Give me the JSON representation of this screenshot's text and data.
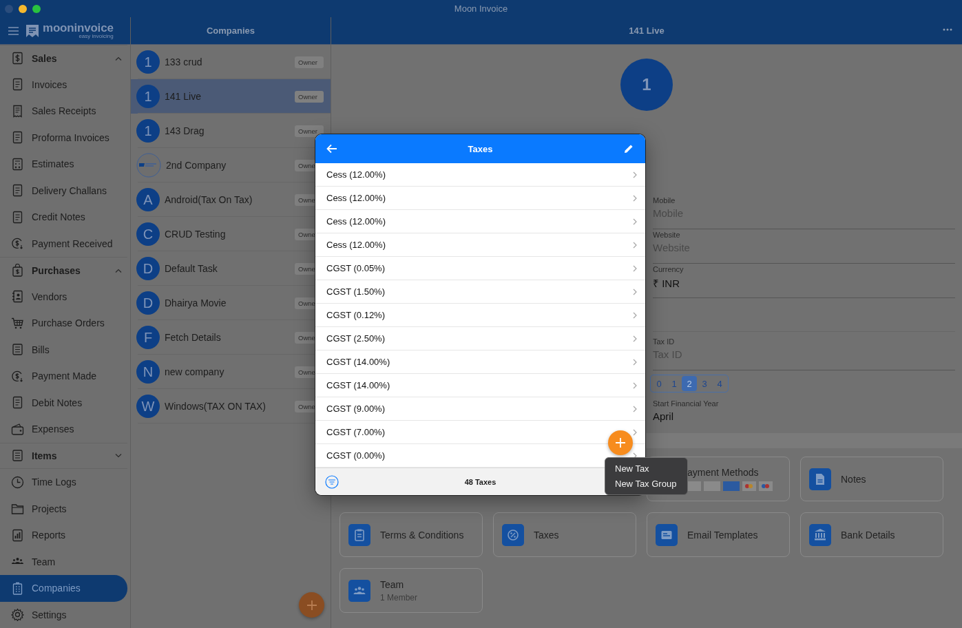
{
  "window": {
    "title": "Moon Invoice"
  },
  "sidebar": {
    "logo": {
      "name": "mooninvoice",
      "tagline": "easy invoicing"
    },
    "items": [
      {
        "kind": "section",
        "label": "Sales",
        "expanded": true,
        "selected": false
      },
      {
        "kind": "item",
        "label": "Invoices",
        "selected": false
      },
      {
        "kind": "item",
        "label": "Sales Receipts",
        "selected": false
      },
      {
        "kind": "item",
        "label": "Proforma Invoices",
        "selected": false
      },
      {
        "kind": "item",
        "label": "Estimates",
        "selected": false
      },
      {
        "kind": "item",
        "label": "Delivery Challans",
        "selected": false
      },
      {
        "kind": "item",
        "label": "Credit Notes",
        "selected": false
      },
      {
        "kind": "item",
        "label": "Payment Received",
        "selected": false
      },
      {
        "kind": "section",
        "label": "Purchases",
        "expanded": true,
        "selected": false
      },
      {
        "kind": "item",
        "label": "Vendors",
        "selected": false
      },
      {
        "kind": "item",
        "label": "Purchase Orders",
        "selected": false
      },
      {
        "kind": "item",
        "label": "Bills",
        "selected": false
      },
      {
        "kind": "item",
        "label": "Payment Made",
        "selected": false
      },
      {
        "kind": "item",
        "label": "Debit Notes",
        "selected": false
      },
      {
        "kind": "item",
        "label": "Expenses",
        "selected": false
      },
      {
        "kind": "section",
        "label": "Items",
        "expanded": false,
        "selected": false
      },
      {
        "kind": "item",
        "label": "Time Logs",
        "selected": false
      },
      {
        "kind": "item",
        "label": "Projects",
        "selected": false
      },
      {
        "kind": "item",
        "label": "Reports",
        "selected": false
      },
      {
        "kind": "item",
        "label": "Team",
        "selected": false
      },
      {
        "kind": "item",
        "label": "Companies",
        "selected": true
      },
      {
        "kind": "item",
        "label": "Settings",
        "selected": false
      }
    ]
  },
  "companies": {
    "header": "Companies",
    "rows": [
      {
        "kind": "letter",
        "initial": "1",
        "name": "133 crud",
        "badge": "Owner",
        "selected": false
      },
      {
        "kind": "letter",
        "initial": "1",
        "name": "141 Live",
        "badge": "Owner",
        "selected": true
      },
      {
        "kind": "letter",
        "initial": "1",
        "name": "143 Drag",
        "badge": "Owner",
        "selected": false
      },
      {
        "kind": "logo",
        "name": "2nd Company",
        "badge": "Owne",
        "selected": false
      },
      {
        "kind": "letter",
        "initial": "A",
        "name": "Android(Tax On Tax)",
        "badge": "Owne",
        "selected": false
      },
      {
        "kind": "letter",
        "initial": "C",
        "name": "CRUD Testing",
        "badge": "Owne",
        "selected": false
      },
      {
        "kind": "letter",
        "initial": "D",
        "name": "Default Task",
        "badge": "Owne",
        "selected": false
      },
      {
        "kind": "letter",
        "initial": "D",
        "name": "Dhairya Movie",
        "badge": "Owne",
        "selected": false
      },
      {
        "kind": "letter",
        "initial": "F",
        "name": "Fetch Details",
        "badge": "Owne",
        "selected": false
      },
      {
        "kind": "letter",
        "initial": "N",
        "name": "new company",
        "badge": "Owne",
        "selected": false
      },
      {
        "kind": "letter",
        "initial": "W",
        "name": "Windows(TAX ON TAX)",
        "badge": "Owne",
        "selected": false
      }
    ]
  },
  "detail": {
    "title": "141 Live",
    "avatar": "1",
    "fields": [
      {
        "label": "Mobile",
        "placeholder": "Mobile"
      },
      {
        "label": "Website",
        "placeholder": "Website"
      },
      {
        "label": "Currency",
        "value": "₹ INR"
      },
      {
        "label": "Tax ID",
        "placeholder": "Tax ID"
      }
    ],
    "decimals": [
      {
        "label": "0",
        "selected": false
      },
      {
        "label": "1",
        "selected": false
      },
      {
        "label": "2",
        "selected": true
      },
      {
        "label": "3",
        "selected": false
      },
      {
        "label": "4",
        "selected": false
      }
    ],
    "financial_year": {
      "label": "Start Financial Year",
      "value": "April"
    },
    "cards": [
      {
        "kind": "payment",
        "title": "ayment Methods"
      },
      {
        "kind": "notes",
        "title": "Notes"
      },
      {
        "kind": "terms",
        "title": "Terms & Conditions"
      },
      {
        "kind": "taxes",
        "title": "Taxes"
      },
      {
        "kind": "email",
        "title": "Email Templates"
      },
      {
        "kind": "bank",
        "title": "Bank Details"
      },
      {
        "kind": "team",
        "title": "Team",
        "subtitle": "1 Member"
      }
    ]
  },
  "taxes_dialog": {
    "title": "Taxes",
    "rows": [
      "Cess (12.00%)",
      "Cess (12.00%)",
      "Cess (12.00%)",
      "Cess (12.00%)",
      "CGST (0.05%)",
      "CGST (1.50%)",
      "CGST (0.12%)",
      "CGST (2.50%)",
      "CGST (14.00%)",
      "CGST (14.00%)",
      "CGST (9.00%)",
      "CGST (7.00%)",
      "CGST (0.00%)"
    ],
    "count": "48 Taxes",
    "menu": [
      "New Tax",
      "New Tax Group"
    ]
  }
}
